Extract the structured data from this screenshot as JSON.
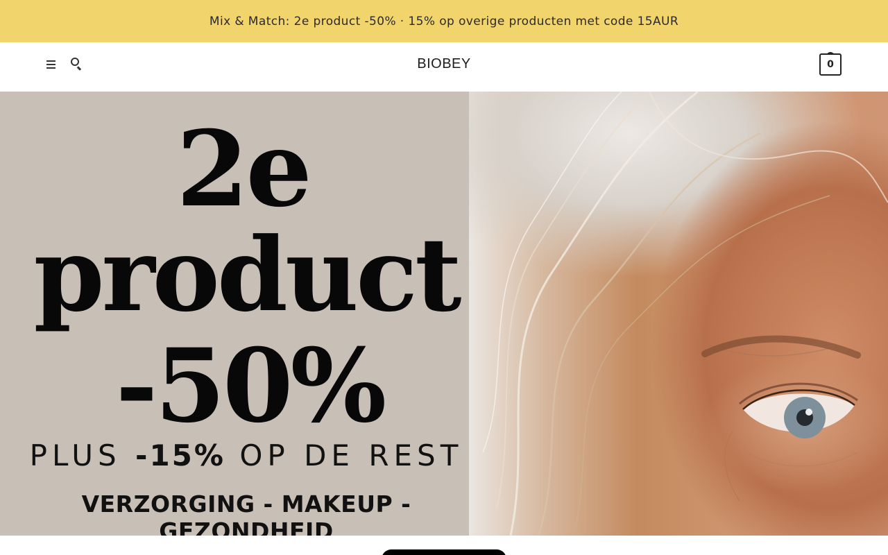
{
  "promo_bar": {
    "text": "Mix & Match: 2e product -50% · 15% op overige producten met code 15AUR"
  },
  "header": {
    "logo": "BIOBEY",
    "cart_count": "0"
  },
  "hero": {
    "line_1": "2e",
    "line_2": "product",
    "line_3": "-50%",
    "plus_prefix": "PLUS ",
    "plus_bold": "-15%",
    "plus_suffix": " OP DE REST",
    "categories": "VERZORGING - MAKEUP - GEZONDHEID"
  },
  "colors": {
    "promo_bar_bg": "#f2d46c",
    "hero_left_bg": "#c8bfb7",
    "cta_bg": "#000000"
  },
  "icons": [
    "menu-icon",
    "search-icon",
    "cart-icon"
  ]
}
